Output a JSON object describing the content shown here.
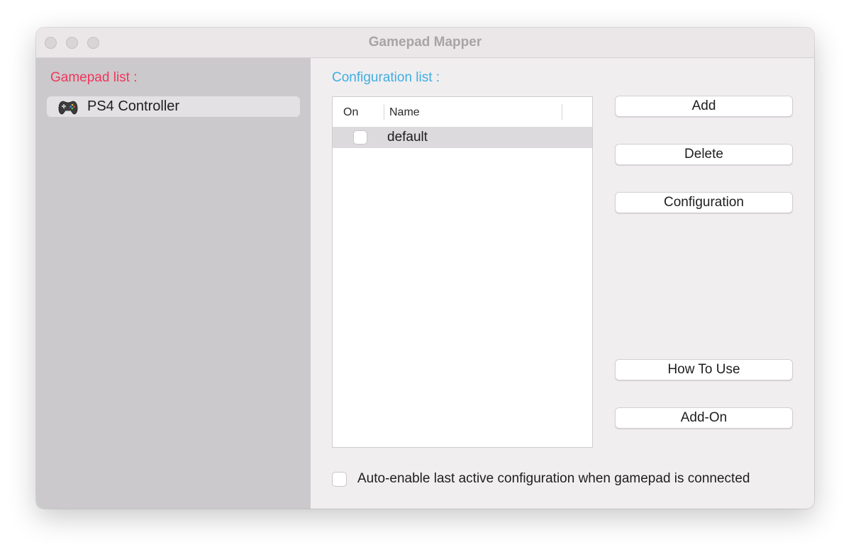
{
  "window": {
    "title": "Gamepad Mapper"
  },
  "sidebar": {
    "heading": "Gamepad list :",
    "items": [
      {
        "label": "PS4 Controller",
        "icon": "gamepad-icon"
      }
    ]
  },
  "main": {
    "heading": "Configuration list :",
    "table": {
      "columns": [
        "On",
        "Name",
        ""
      ],
      "rows": [
        {
          "on": false,
          "name": "default"
        }
      ]
    },
    "buttons": {
      "add": "Add",
      "delete": "Delete",
      "configuration": "Configuration",
      "how_to_use": "How To Use",
      "add_on": "Add-On"
    },
    "auto_enable": {
      "checked": false,
      "label": "Auto-enable last active configuration when gamepad is connected"
    }
  },
  "colors": {
    "gamepad_heading": "#f0365c",
    "config_heading": "#3eaee0",
    "sidebar_bg": "#cbc9cc",
    "window_bg": "#f1eef0"
  }
}
